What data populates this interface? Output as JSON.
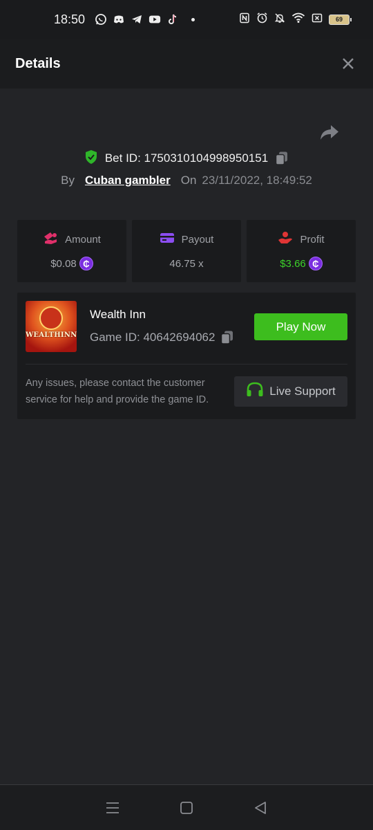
{
  "status_bar": {
    "time": "18:50",
    "battery": "69",
    "app_icons": [
      "whatsapp-icon",
      "discord-icon",
      "telegram-icon",
      "youtube-icon",
      "tiktok-icon"
    ],
    "system_icons": [
      "nfc-icon",
      "alarm-icon",
      "mute-icon",
      "wifi-icon",
      "no-sim-icon"
    ]
  },
  "header": {
    "title": "Details",
    "close_icon": "close-icon"
  },
  "bet": {
    "id_label": "Bet ID: 1750310104998950151",
    "by_label": "By",
    "username": "Cuban gambler",
    "on_label": "On",
    "date": "23/11/2022, 18:49:52"
  },
  "stats": {
    "amount": {
      "label": "Amount",
      "value": "$0.08"
    },
    "payout": {
      "label": "Payout",
      "value": "46.75 x"
    },
    "profit": {
      "label": "Profit",
      "value": "$3.66"
    },
    "coin_symbol": "₵"
  },
  "game": {
    "thumb_text": "WEALTHINN",
    "name": "Wealth Inn",
    "id_label": "Game ID: 40642694062",
    "play_label": "Play Now",
    "issue_text": "Any issues, please contact the customer service for help and provide the game ID.",
    "support_label": "Live Support"
  },
  "colors": {
    "background": "#232427",
    "card": "#1a1b1d",
    "accent_green": "#3dbd1e",
    "profit_green": "#3dd22a",
    "coin_purple": "#7b2ee0"
  }
}
